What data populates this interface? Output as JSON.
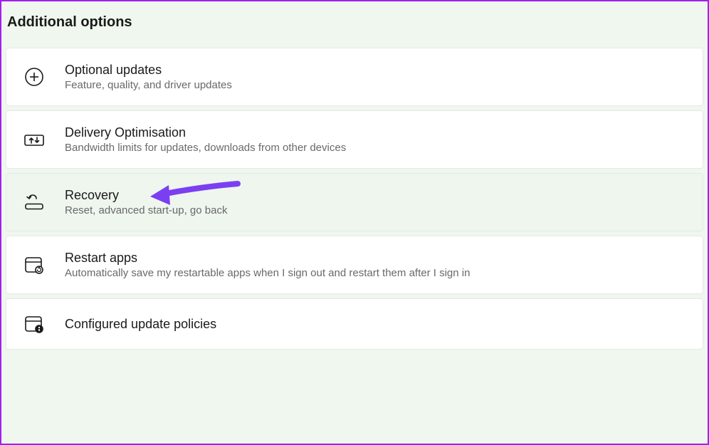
{
  "section_title": "Additional options",
  "options": [
    {
      "icon": "plus-circle",
      "title": "Optional updates",
      "subtitle": "Feature, quality, and driver updates",
      "highlighted": false
    },
    {
      "icon": "delivery",
      "title": "Delivery Optimisation",
      "subtitle": "Bandwidth limits for updates, downloads from other devices",
      "highlighted": false
    },
    {
      "icon": "recovery",
      "title": "Recovery",
      "subtitle": "Reset, advanced start-up, go back",
      "highlighted": true,
      "arrow": true
    },
    {
      "icon": "restart-apps",
      "title": "Restart apps",
      "subtitle": "Automatically save my restartable apps when I sign out and restart them after I sign in",
      "highlighted": false
    },
    {
      "icon": "policies",
      "title": "Configured update policies",
      "subtitle": "",
      "highlighted": false
    }
  ]
}
